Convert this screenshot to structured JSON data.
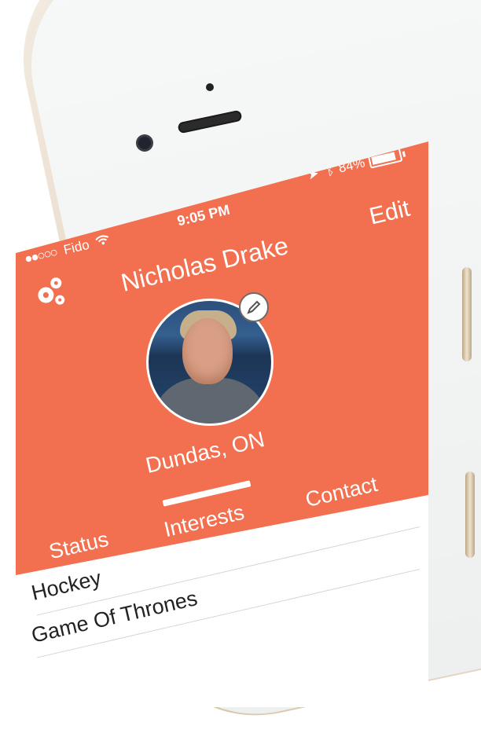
{
  "status_bar": {
    "carrier": "Fido",
    "time": "9:05 PM",
    "battery": "84%"
  },
  "header": {
    "edit": "Edit",
    "name": "Nicholas Drake",
    "location": "Dundas, ON"
  },
  "tabs": [
    {
      "label": "Status"
    },
    {
      "label": "Interests"
    },
    {
      "label": "Contact"
    }
  ],
  "interests": [
    {
      "label": "Hockey"
    },
    {
      "label": "Game Of Thrones"
    }
  ],
  "icons": {
    "settings": "settings-icon",
    "edit_avatar": "pencil-icon",
    "location_services": "location-arrow-icon",
    "bluetooth": "bluetooth-icon",
    "wifi": "wifi-icon"
  },
  "colors": {
    "accent": "#f26f50",
    "phone_gold": "#d7c3a6"
  }
}
